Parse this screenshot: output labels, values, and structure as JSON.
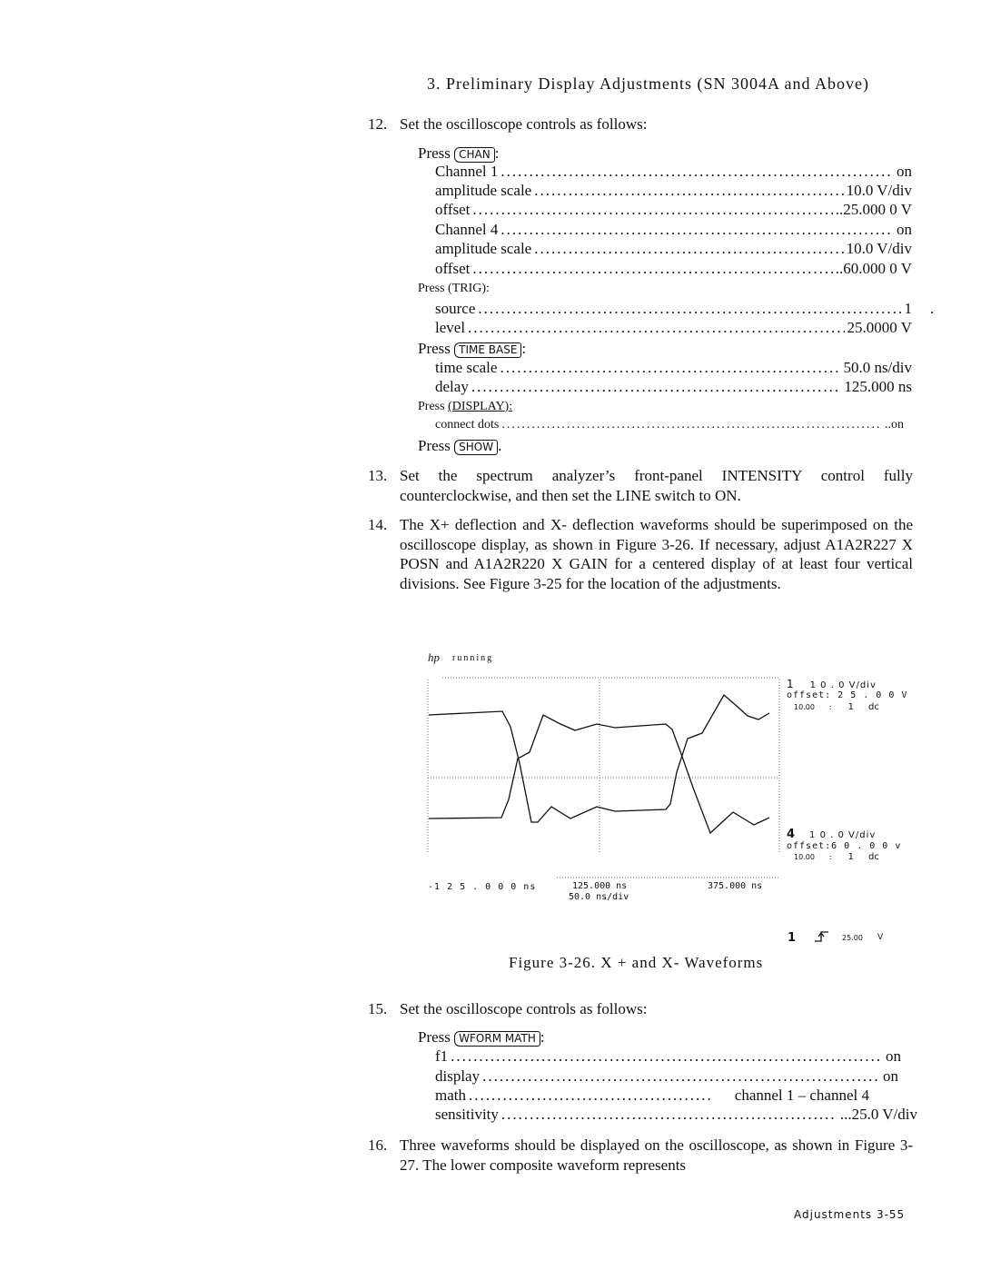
{
  "header": "3. Preliminary Display Adjustments (SN 3004A and Above)",
  "step12": {
    "num": "12.",
    "text": "Set the oscilloscope controls as follows:",
    "chan": {
      "press": "Press",
      "key": "CHAN",
      "rows": [
        {
          "label": "Channel 1",
          "value": "on"
        },
        {
          "label": "amplitude scale",
          "value": "10.0 V/div"
        },
        {
          "label": "offset",
          "value": "..25.000 0 V"
        },
        {
          "label": "Channel 4",
          "value": "on"
        },
        {
          "label": "amplitude scale",
          "value": "10.0 V/div"
        },
        {
          "label": "offset",
          "value": "..60.000 0 V"
        }
      ]
    },
    "trig": {
      "press": "Press (TRIG):",
      "rows": [
        {
          "label": "source",
          "value": "1"
        },
        {
          "label": "level",
          "value": "25.0000 V"
        }
      ],
      "stray": "."
    },
    "timebase": {
      "press": "Press",
      "key": "TIME BASE",
      "rows": [
        {
          "label": "time scale",
          "value": "50.0 ns/div"
        },
        {
          "label": "delay",
          "value": "125.000 ns"
        }
      ]
    },
    "display": {
      "press": "Press",
      "key": "(DISPLAY):",
      "rows": [
        {
          "label": "connect dots",
          "value": "..on"
        }
      ]
    },
    "show": {
      "press": "Press",
      "key": "SHOW"
    }
  },
  "step13": {
    "num": "13.",
    "text": "Set the spectrum analyzer’s front-panel INTENSITY control fully counterclockwise, and then set the LINE switch to ON."
  },
  "step14": {
    "num": "14.",
    "text": "The X+ deflection and X- deflection waveforms should be superimposed on the oscilloscope display, as shown in Figure 3-26. If necessary, adjust A1A2R227 X POSN and A1A2R220 X GAIN for a centered display of at least four vertical divisions. See Figure 3-25 for the location of the adjustments."
  },
  "scope": {
    "logo": "hp",
    "status": "running",
    "ch1": {
      "num": "1",
      "scale": "1 0 . 0  V/div",
      "offset": "offset: 2 5 . 0 0  V",
      "probe": "10.00",
      "sep": ":",
      "coupling_ratio": "1",
      "coupling": "dc"
    },
    "ch4": {
      "num": "4",
      "scale": "1 0 . 0  V/div",
      "offset": "offset:6 0 . 0 0  v",
      "probe": "10.00",
      "sep": ":",
      "coupling_ratio": "1",
      "coupling": "dc"
    },
    "time_left": "-1 2 5 . 0 0 0  ns",
    "time_center": "125.000 ns",
    "time_right": "375.000 ns",
    "timebase": "50.0 ns/div",
    "trigger": {
      "source": "1",
      "slope": "rising-edge-icon",
      "level": "25.00",
      "unit": "V"
    }
  },
  "caption": "Figure 3-26. X + and X- Waveforms",
  "step15": {
    "num": "15.",
    "text": "Set the oscilloscope controls as follows:",
    "press": "Press",
    "key": "WFORM MATH",
    "rows": [
      {
        "label": "f1",
        "value": "on"
      },
      {
        "label": "display",
        "value": "on"
      },
      {
        "label": "math",
        "value": "channel 1 – channel 4"
      },
      {
        "label": "sensitivity",
        "value": "...25.0 V/div"
      }
    ]
  },
  "step16": {
    "num": "16.",
    "text": "Three waveforms should be displayed on the oscilloscope, as shown in Figure 3-27. The lower composite waveform represents"
  },
  "footer": "Adjustments 3-55"
}
